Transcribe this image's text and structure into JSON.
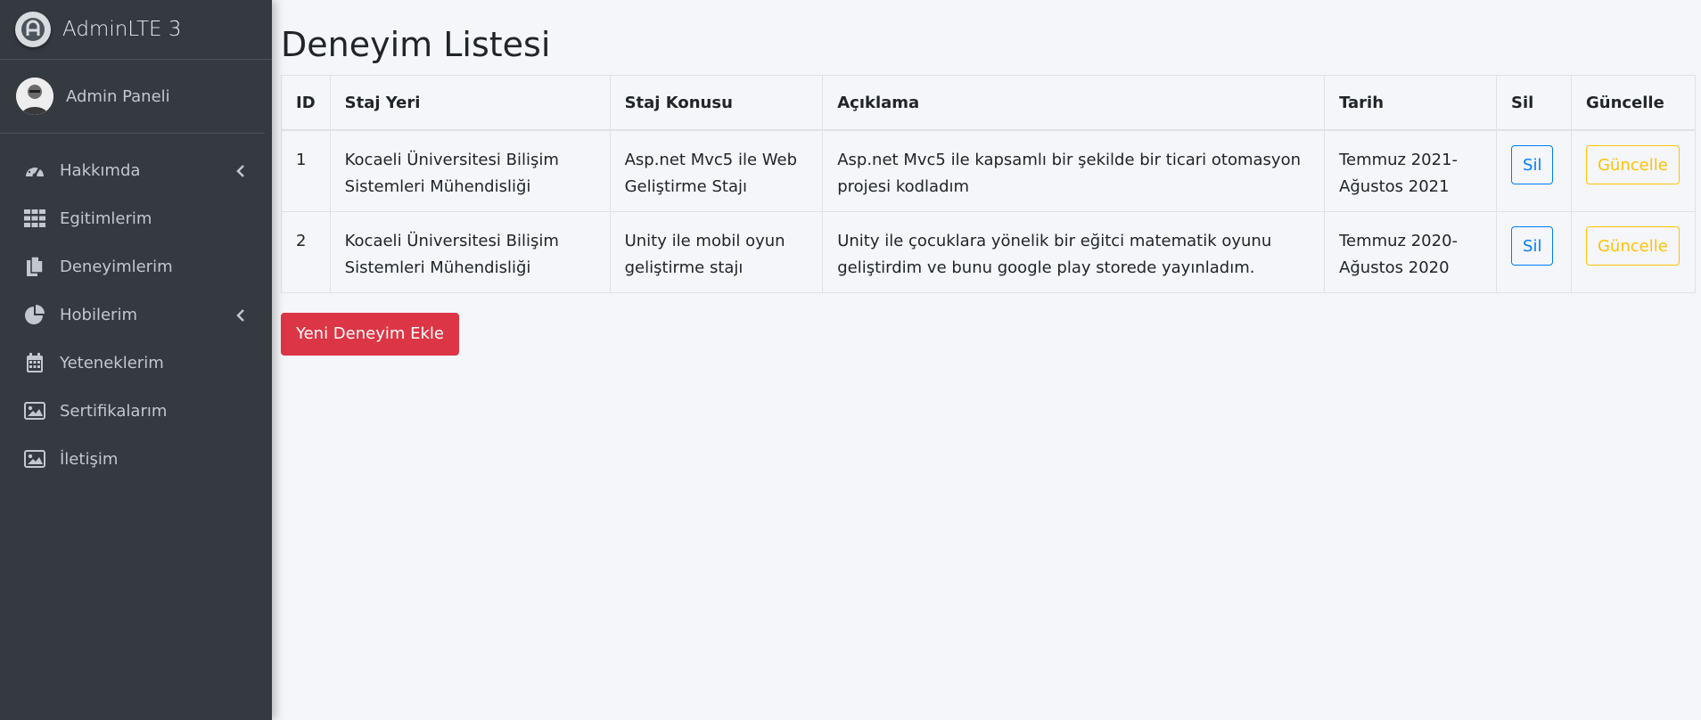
{
  "brand": {
    "name": "AdminLTE 3"
  },
  "user": {
    "name": "Admin Paneli"
  },
  "sidebar": {
    "items": [
      {
        "label": "Hakkımda",
        "icon": "tachometer-icon",
        "has_caret": true
      },
      {
        "label": "Egitimlerim",
        "icon": "grid-icon",
        "has_caret": false
      },
      {
        "label": "Deneyimlerim",
        "icon": "copy-icon",
        "has_caret": false
      },
      {
        "label": "Hobilerim",
        "icon": "pie-chart-icon",
        "has_caret": true
      },
      {
        "label": "Yeteneklerim",
        "icon": "calendar-icon",
        "has_caret": false
      },
      {
        "label": "Sertifikalarım",
        "icon": "image-icon",
        "has_caret": false
      },
      {
        "label": "İletişim",
        "icon": "image-icon",
        "has_caret": false
      }
    ]
  },
  "main": {
    "title": "Deneyim Listesi",
    "table": {
      "headers": [
        "ID",
        "Staj Yeri",
        "Staj Konusu",
        "Açıklama",
        "Tarih",
        "Sil",
        "Güncelle"
      ],
      "rows": [
        {
          "id": "1",
          "yer": "Kocaeli Üniversitesi Bilişim Sistemleri Mühendisliği",
          "konu": "Asp.net Mvc5 ile Web Geliştirme Stajı",
          "aciklama": "Asp.net Mvc5 ile kapsamlı bir şekilde bir ticari otomasyon projesi kodladım",
          "tarih": "Temmuz 2021-Ağustos 2021",
          "sil": "Sil",
          "guncelle": "Güncelle"
        },
        {
          "id": "2",
          "yer": "Kocaeli Üniversitesi Bilişim Sistemleri Mühendisliği",
          "konu": "Unity ile mobil oyun geliştirme stajı",
          "aciklama": "Unity ile çocuklara yönelik bir eğitci matematik oyunu geliştirdim ve bunu google play storede yayınladım.",
          "tarih": "Temmuz 2020-Ağustos 2020",
          "sil": "Sil",
          "guncelle": "Güncelle"
        }
      ]
    },
    "add_button": "Yeni Deneyim Ekle"
  },
  "colors": {
    "sidebar_bg": "#343a40",
    "sidebar_text": "#c2c7d0",
    "page_bg": "#f4f6f9",
    "primary": "#007bff",
    "warning": "#ffc107",
    "danger": "#dc3545"
  }
}
